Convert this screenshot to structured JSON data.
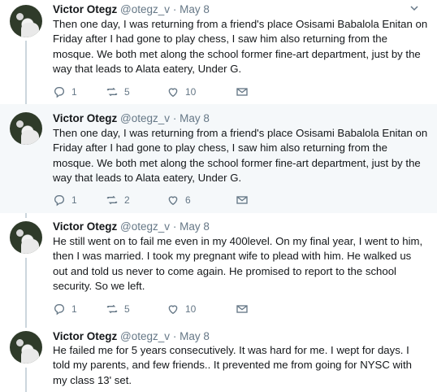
{
  "tweets": [
    {
      "name": "Victor Otegz",
      "handle": "@otegz_v",
      "separator": "·",
      "date": "May 8",
      "text": "Then one day, I was returning from a friend's place Osisami Babalola Enitan on Friday after I had gone to play chess, I saw him also returning from the mosque. We both met along the school former fine-art department, just by the way that leads to Alata eatery, Under G.",
      "replies": "1",
      "retweets": "5",
      "likes": "10"
    },
    {
      "name": "Victor Otegz",
      "handle": "@otegz_v",
      "separator": "·",
      "date": "May 8",
      "text": "Then one day, I was returning from a friend's place Osisami Babalola Enitan on Friday after I had gone to play chess, I saw him also returning from the mosque. We both met along the school former fine-art department, just by the way that leads to Alata eatery, Under G.",
      "replies": "1",
      "retweets": "2",
      "likes": "6"
    },
    {
      "name": "Victor Otegz",
      "handle": "@otegz_v",
      "separator": "·",
      "date": "May 8",
      "text": "He still went on to fail me even in my 400level. On my final year, I went to him, then I was married. I took my pregnant wife to plead with him. He walked us out and told us never to come again. He promised to report to the school security. So we left.",
      "replies": "1",
      "retweets": "5",
      "likes": "10"
    },
    {
      "name": "Victor Otegz",
      "handle": "@otegz_v",
      "separator": "·",
      "date": "May 8",
      "text": "He failed me for 5 years consecutively. It was hard for me. I wept for days. I told my parents, and few friends.. It prevented me from going for NYSC with my class 13' set."
    }
  ],
  "icons": {
    "reply": "reply-icon",
    "retweet": "retweet-icon",
    "like": "heart-icon",
    "dm": "envelope-icon",
    "menu": "chevron-down-icon"
  },
  "colors": {
    "highlight_bg": "#f5f8fa",
    "thread_line": "#ccd6dd",
    "muted": "#657786",
    "text": "#14171a"
  }
}
